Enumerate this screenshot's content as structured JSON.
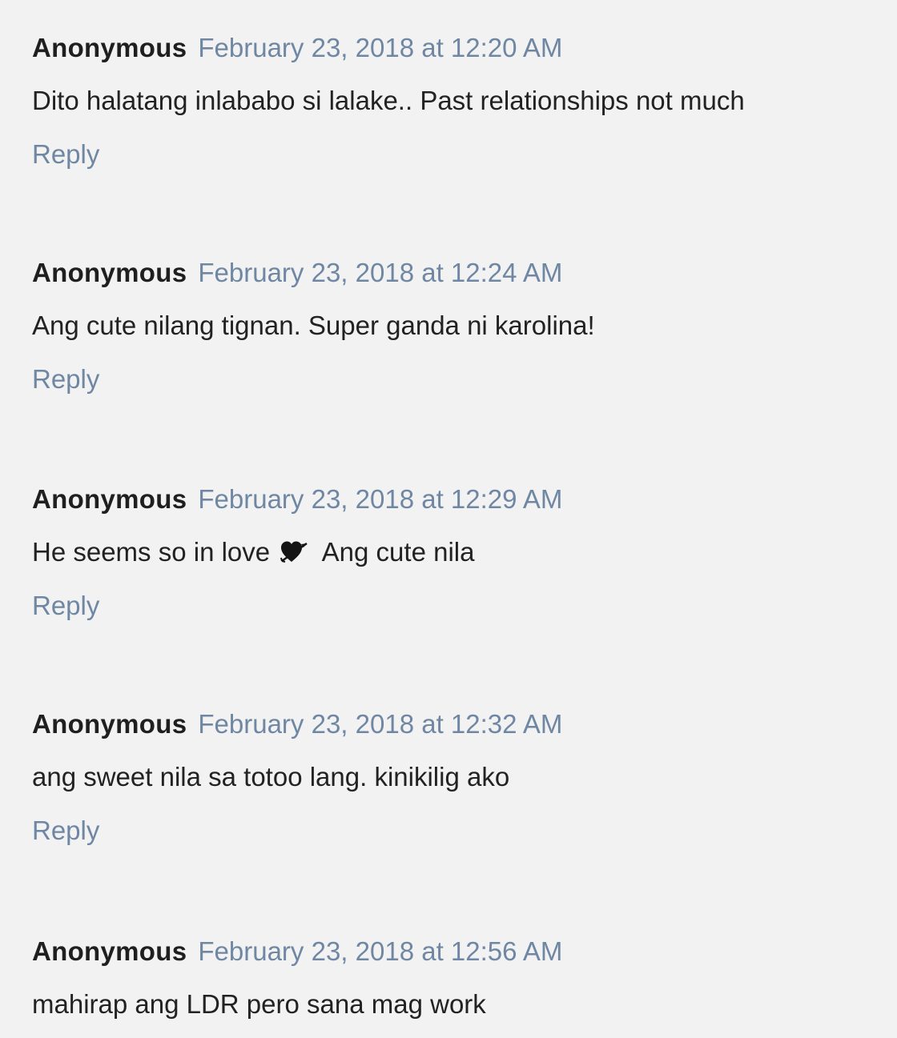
{
  "comments": [
    {
      "author": "Anonymous",
      "timestamp": "February 23, 2018 at 12:20 AM",
      "text_before": "Dito halatang inlababo si lalake.. Past relationships not much",
      "icon": "",
      "text_after": "",
      "reply_label": "Reply"
    },
    {
      "author": "Anonymous",
      "timestamp": "February 23, 2018 at 12:24 AM",
      "text_before": "Ang cute nilang tignan. Super ganda ni karolina!",
      "icon": "",
      "text_after": "",
      "reply_label": "Reply"
    },
    {
      "author": "Anonymous",
      "timestamp": "February 23, 2018 at 12:29 AM",
      "text_before": "He seems so in love",
      "icon": "heart-with-arrow-icon",
      "text_after": "Ang cute nila",
      "reply_label": "Reply"
    },
    {
      "author": "Anonymous",
      "timestamp": "February 23, 2018 at 12:32 AM",
      "text_before": "ang sweet nila sa totoo lang. kinikilig ako",
      "icon": "",
      "text_after": "",
      "reply_label": "Reply"
    },
    {
      "author": "Anonymous",
      "timestamp": "February 23, 2018 at 12:56 AM",
      "text_before": "mahirap ang LDR pero sana mag work",
      "icon": "",
      "text_after": "",
      "reply_label": ""
    }
  ],
  "colors": {
    "background": "#f2f2f2",
    "author": "#1f1f1f",
    "link": "#6f87a3",
    "body_text": "#222222"
  }
}
